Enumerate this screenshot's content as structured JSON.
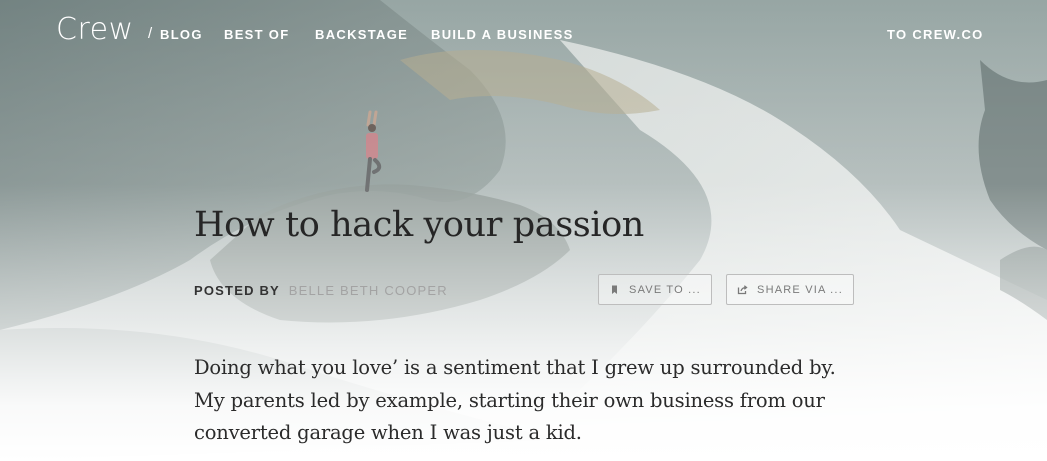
{
  "nav": {
    "logo": "Crew",
    "separator": "/",
    "links": [
      "BLOG",
      "BEST OF",
      "BACKSTAGE",
      "BUILD A BUSINESS"
    ],
    "external_link": "TO CREW.CO"
  },
  "article": {
    "title": "How to hack your passion",
    "posted_by_label": "POSTED BY",
    "author": "BELLE BETH COOPER",
    "save_button": "SAVE TO ...",
    "share_button": "SHARE VIA ...",
    "lead_lines": [
      "Doing what you love’ is a sentiment that I grew up surrounded by.",
      "My parents led by example, starting their own business from our",
      "converted garage when I was just a kid."
    ]
  },
  "icons": {
    "save": "bookmark-icon",
    "share": "share-icon"
  },
  "colors": {
    "title": "#262626",
    "author": "#a3a3a3",
    "button_border": "#bdbdbd",
    "nav_text": "#ffffff"
  }
}
